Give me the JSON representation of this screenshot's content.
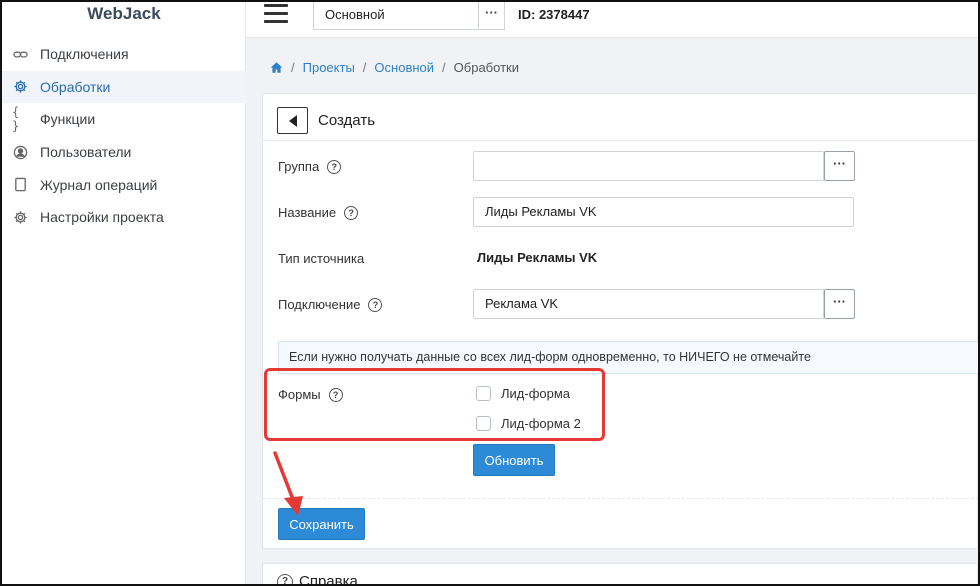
{
  "app": {
    "logo": "WebJack"
  },
  "sidebar": {
    "items": [
      {
        "label": "Подключения",
        "icon": "link-icon",
        "active": false
      },
      {
        "label": "Обработки",
        "icon": "gear-icon",
        "active": true
      },
      {
        "label": "Функции",
        "icon": "braces-icon",
        "active": false
      },
      {
        "label": "Пользователи",
        "icon": "user-icon",
        "active": false
      },
      {
        "label": "Журнал операций",
        "icon": "journal-icon",
        "active": false
      },
      {
        "label": "Настройки проекта",
        "icon": "settings-icon",
        "active": false
      }
    ]
  },
  "topbar": {
    "project_select": "Основной",
    "project_dots": "···",
    "project_id": "ID: 2378447"
  },
  "breadcrumb": {
    "separator": "/",
    "items": [
      "Проекты",
      "Основной",
      "Обработки"
    ]
  },
  "form": {
    "title": "Создать",
    "help_mark": "?",
    "dots": "···",
    "group": {
      "label": "Группа",
      "value": ""
    },
    "name": {
      "label": "Название",
      "value": "Лиды Рекламы VK"
    },
    "source_type": {
      "label": "Тип источника",
      "value": "Лиды Рекламы VK"
    },
    "connection": {
      "label": "Подключение",
      "value": "Реклама VK"
    },
    "info": "Если нужно получать данные со всех лид-форм одновременно, то НИЧЕГО не отмечайте",
    "forms": {
      "label": "Формы",
      "options": [
        {
          "label": "Лид-форма",
          "checked": false
        },
        {
          "label": "Лид-форма 2",
          "checked": false
        }
      ]
    },
    "refresh_button": "Обновить",
    "save_button": "Сохранить"
  },
  "help_card": {
    "title": "Справка"
  },
  "colors": {
    "accent": "#2d8ad6",
    "highlight": "#e53935"
  }
}
